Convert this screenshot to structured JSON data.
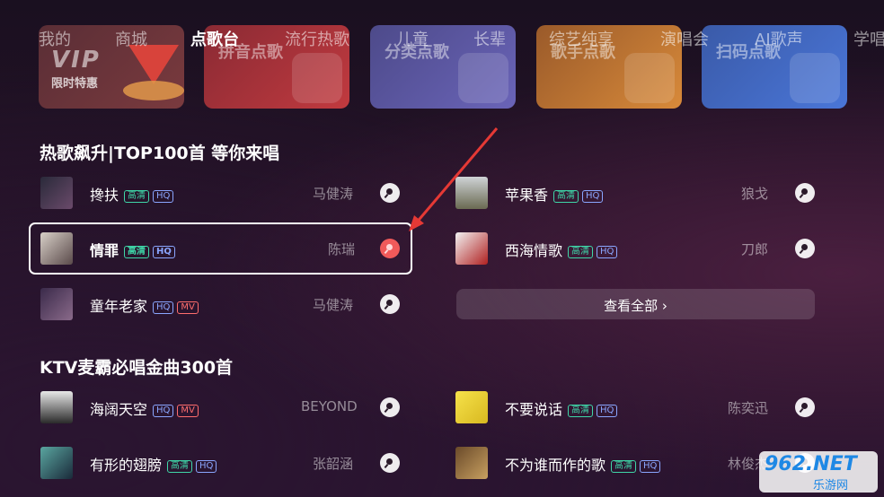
{
  "nav": {
    "tabs": [
      "我的",
      "商城",
      "点歌台",
      "流行热歌",
      "儿童",
      "长辈",
      "综艺纯享",
      "演唱会",
      "AI歌声",
      "学唱"
    ],
    "active": "点歌台"
  },
  "cards": {
    "vip_main": "VIP",
    "vip_sub": "限时特惠",
    "pinyin": "拼音点歌",
    "category": "分类点歌",
    "singer": "歌手点歌",
    "scan": "扫码点歌"
  },
  "section1": {
    "title": "热歌飙升|TOP100首 等你来唱",
    "left": [
      {
        "title": "搀扶",
        "badges": [
          "高清",
          "HQ"
        ],
        "artist": "马健涛"
      },
      {
        "title": "情罪",
        "badges": [
          "高清",
          "HQ"
        ],
        "artist": "陈瑞"
      },
      {
        "title": "童年老家",
        "badges": [
          "HQ",
          "MV"
        ],
        "artist": "马健涛"
      }
    ],
    "right": [
      {
        "title": "苹果香",
        "badges": [
          "高清",
          "HQ"
        ],
        "artist": "狼戈"
      },
      {
        "title": "西海情歌",
        "badges": [
          "高清",
          "HQ"
        ],
        "artist": "刀郎"
      }
    ],
    "view_all": "查看全部 ›"
  },
  "section2": {
    "title": "KTV麦霸必唱金曲300首",
    "left": [
      {
        "title": "海阔天空",
        "badges": [
          "HQ",
          "MV"
        ],
        "artist": "BEYOND"
      },
      {
        "title": "有形的翅膀",
        "badges": [
          "高清",
          "HQ"
        ],
        "artist": "张韶涵"
      }
    ],
    "right": [
      {
        "title": "不要说话",
        "badges": [
          "高清",
          "HQ"
        ],
        "artist": "陈奕迅"
      },
      {
        "title": "不为谁而作的歌",
        "badges": [
          "高清",
          "HQ"
        ],
        "artist": "林俊杰"
      }
    ]
  },
  "watermark": {
    "top": "962.NET",
    "bottom": "乐游网"
  },
  "colors": {
    "accent_red": "#f05a5a",
    "badge_hd": "#3fd6a8",
    "badge_hq": "#8aa6ff",
    "badge_mv": "#ff6d6d",
    "arrow": "#e53935"
  }
}
